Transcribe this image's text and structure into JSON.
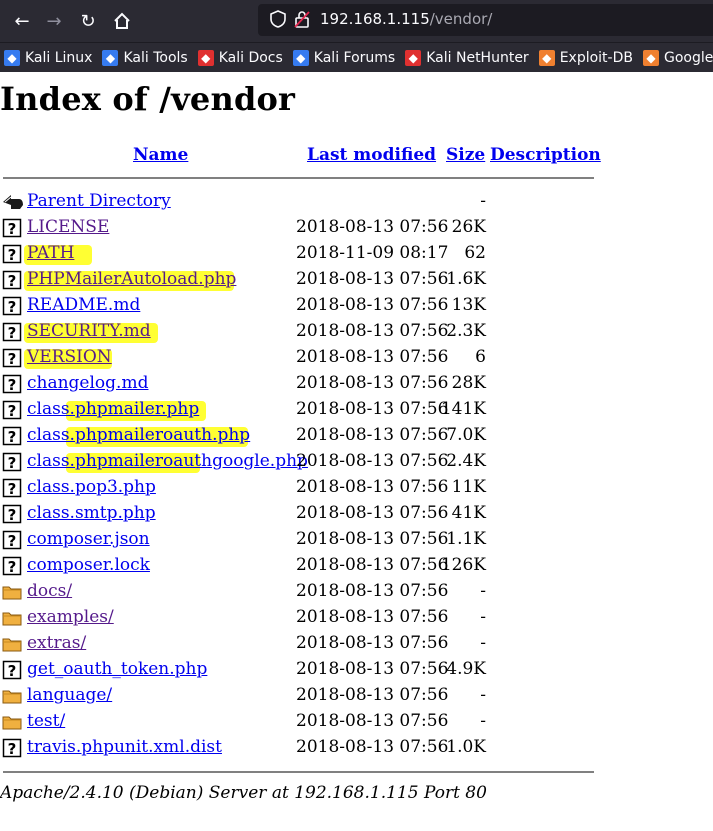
{
  "browser": {
    "url_host": "192.168.1.115",
    "url_path": "/vendor/",
    "bookmarks": [
      {
        "label": "Kali Linux",
        "icon": "kali-dragon-icon",
        "color": "#367bf0"
      },
      {
        "label": "Kali Tools",
        "icon": "kali-tools-icon",
        "color": "#367bf0"
      },
      {
        "label": "Kali Docs",
        "icon": "kali-docs-icon",
        "color": "#e03030"
      },
      {
        "label": "Kali Forums",
        "icon": "kali-forums-icon",
        "color": "#367bf0"
      },
      {
        "label": "Kali NetHunter",
        "icon": "nethunter-icon",
        "color": "#e03030"
      },
      {
        "label": "Exploit-DB",
        "icon": "exploit-db-icon",
        "color": "#f08030"
      },
      {
        "label": "Google Ha",
        "icon": "google-hacking-icon",
        "color": "#f08030"
      }
    ]
  },
  "page": {
    "title": "Index of /vendor",
    "columns": {
      "name": "Name",
      "last_modified": "Last modified",
      "size": "Size",
      "description": "Description"
    },
    "highlight_color": "#ffff33",
    "rows": [
      {
        "name": "Parent Directory",
        "date": "",
        "size": "-",
        "icon": "back-icon",
        "visited": false
      },
      {
        "name": "LICENSE",
        "date": "2018-08-13 07:56",
        "size": "26K",
        "icon": "unknown-file-icon",
        "visited": true
      },
      {
        "name": "PATH",
        "date": "2018-11-09 08:17",
        "size": "62",
        "icon": "unknown-file-icon",
        "visited": true
      },
      {
        "name": "PHPMailerAutoload.php",
        "date": "2018-08-13 07:56",
        "size": "1.6K",
        "icon": "unknown-file-icon",
        "visited": true
      },
      {
        "name": "README.md",
        "date": "2018-08-13 07:56",
        "size": "13K",
        "icon": "unknown-file-icon",
        "visited": false
      },
      {
        "name": "SECURITY.md",
        "date": "2018-08-13 07:56",
        "size": "2.3K",
        "icon": "unknown-file-icon",
        "visited": true
      },
      {
        "name": "VERSION",
        "date": "2018-08-13 07:56",
        "size": "6",
        "icon": "unknown-file-icon",
        "visited": true
      },
      {
        "name": "changelog.md",
        "date": "2018-08-13 07:56",
        "size": "28K",
        "icon": "unknown-file-icon",
        "visited": false
      },
      {
        "name": "class.phpmailer.php",
        "date": "2018-08-13 07:56",
        "size": "141K",
        "icon": "unknown-file-icon",
        "visited": false
      },
      {
        "name": "class.phpmaileroauth.php",
        "date": "2018-08-13 07:56",
        "size": "7.0K",
        "icon": "unknown-file-icon",
        "visited": false
      },
      {
        "name": "class.phpmaileroauthgoogle.php",
        "date": "2018-08-13 07:56",
        "size": "2.4K",
        "icon": "unknown-file-icon",
        "visited": false
      },
      {
        "name": "class.pop3.php",
        "date": "2018-08-13 07:56",
        "size": "11K",
        "icon": "unknown-file-icon",
        "visited": false
      },
      {
        "name": "class.smtp.php",
        "date": "2018-08-13 07:56",
        "size": "41K",
        "icon": "unknown-file-icon",
        "visited": false
      },
      {
        "name": "composer.json",
        "date": "2018-08-13 07:56",
        "size": "1.1K",
        "icon": "unknown-file-icon",
        "visited": false
      },
      {
        "name": "composer.lock",
        "date": "2018-08-13 07:56",
        "size": "126K",
        "icon": "unknown-file-icon",
        "visited": false
      },
      {
        "name": "docs/",
        "date": "2018-08-13 07:56",
        "size": "-",
        "icon": "folder-icon",
        "visited": true
      },
      {
        "name": "examples/",
        "date": "2018-08-13 07:56",
        "size": "-",
        "icon": "folder-icon",
        "visited": true
      },
      {
        "name": "extras/",
        "date": "2018-08-13 07:56",
        "size": "-",
        "icon": "folder-icon",
        "visited": true
      },
      {
        "name": "get_oauth_token.php",
        "date": "2018-08-13 07:56",
        "size": "4.9K",
        "icon": "unknown-file-icon",
        "visited": false
      },
      {
        "name": "language/",
        "date": "2018-08-13 07:56",
        "size": "-",
        "icon": "folder-icon",
        "visited": false
      },
      {
        "name": "test/",
        "date": "2018-08-13 07:56",
        "size": "-",
        "icon": "folder-icon",
        "visited": false
      },
      {
        "name": "travis.phpunit.xml.dist",
        "date": "2018-08-13 07:56",
        "size": "1.0K",
        "icon": "unknown-file-icon",
        "visited": false
      }
    ],
    "footer": "Apache/2.4.10 (Debian) Server at 192.168.1.115 Port 80"
  }
}
